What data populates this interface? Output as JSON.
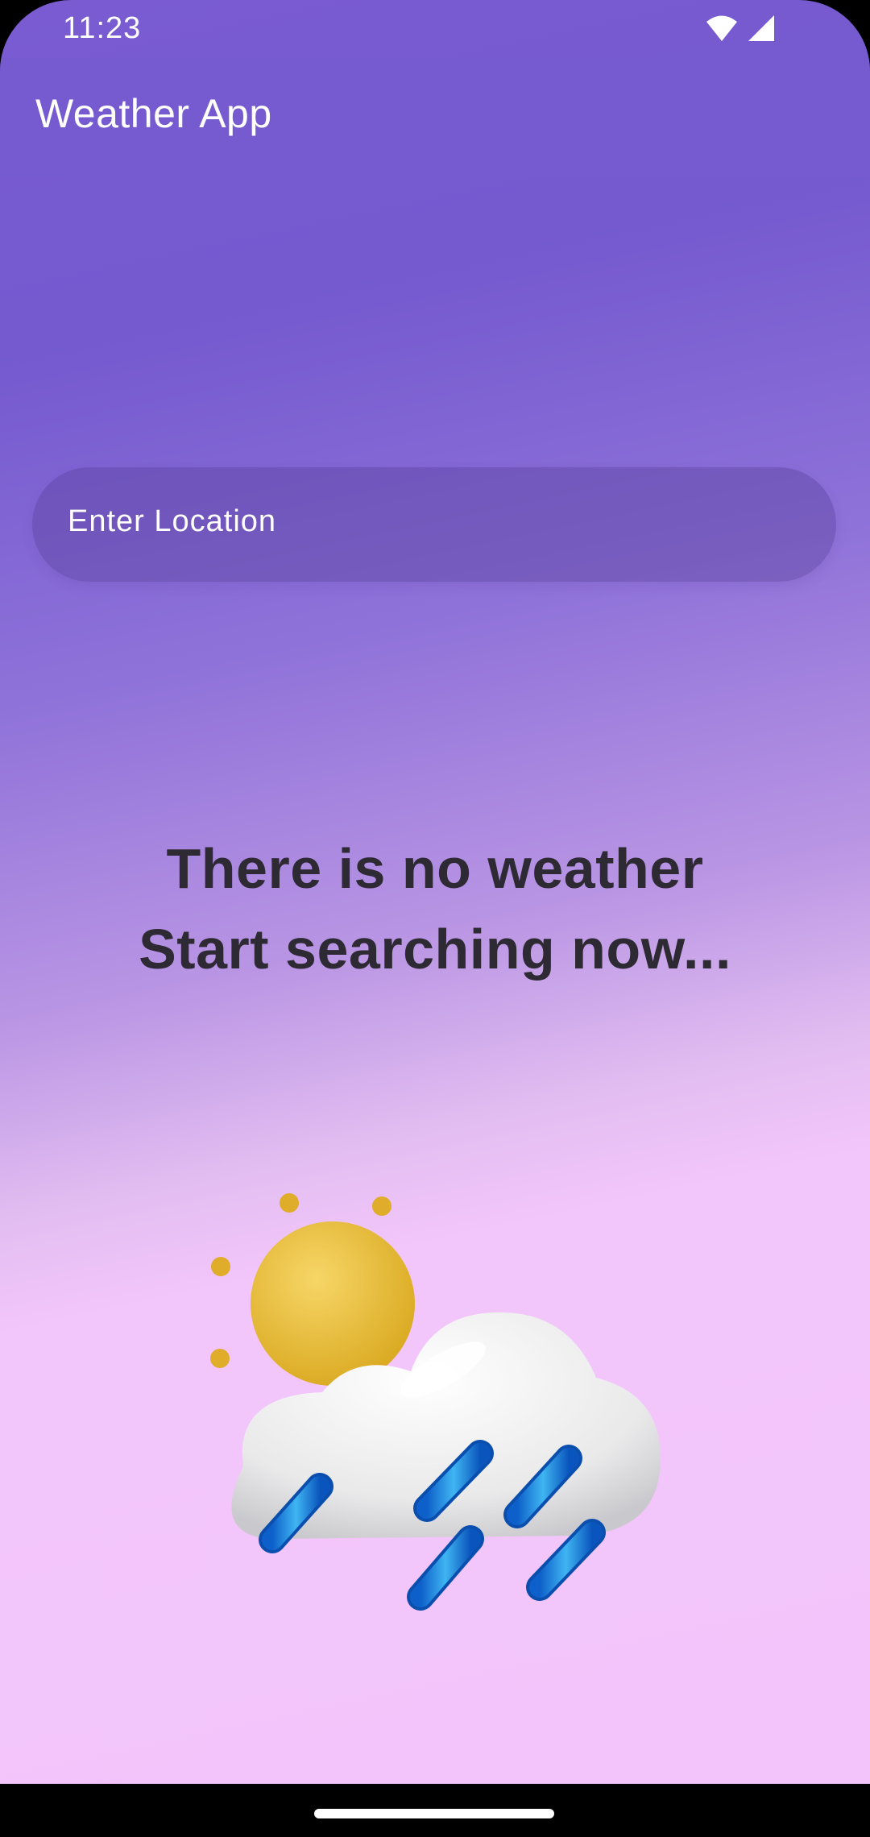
{
  "status_bar": {
    "time": "11:23",
    "icons": [
      "wifi-icon",
      "cellular-signal-icon"
    ]
  },
  "app_bar": {
    "title": "Weather App",
    "color": "#765bd0"
  },
  "search": {
    "placeholder": "Enter Location"
  },
  "empty_state": {
    "line1": "There is no weather",
    "line2": "Start searching now..."
  },
  "illustration": {
    "icon": "sun-cloud-rain-icon"
  },
  "colors": {
    "gradient_top": "#7459cf",
    "gradient_bottom": "#f2c4fb",
    "text_dark": "#2e2a34"
  }
}
